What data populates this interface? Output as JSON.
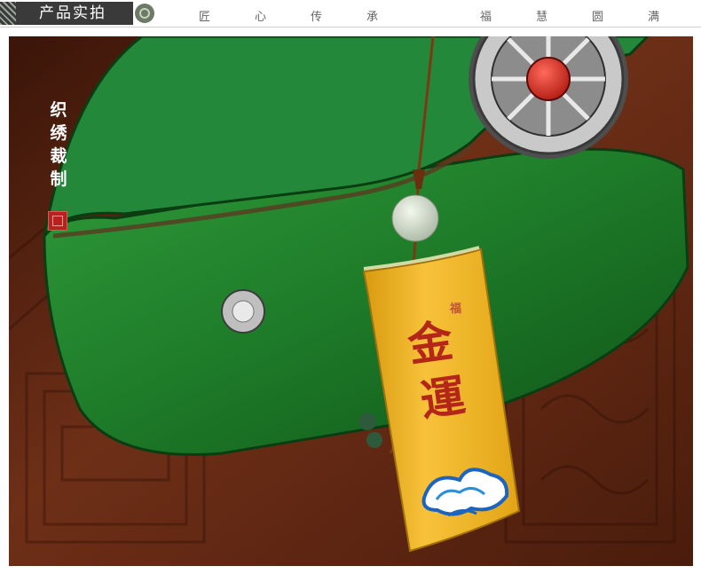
{
  "header": {
    "section_title": "产品实拍",
    "motto_left": [
      "匠",
      "心",
      "传",
      "承"
    ],
    "motto_right": [
      "福",
      "慧",
      "圆",
      "满"
    ]
  },
  "caption": {
    "vertical_text": [
      "织",
      "绣",
      "裁",
      "制"
    ]
  },
  "product": {
    "pouch_characters": [
      "金",
      "運"
    ],
    "pouch_small_mark": "福"
  },
  "colors": {
    "banner_dark": "#3a3a3a",
    "leather_green": "#1f7a2a",
    "pouch_yellow": "#f0b21e",
    "calligraphy_red": "#b42618",
    "wood_brown": "#6a2f18"
  }
}
